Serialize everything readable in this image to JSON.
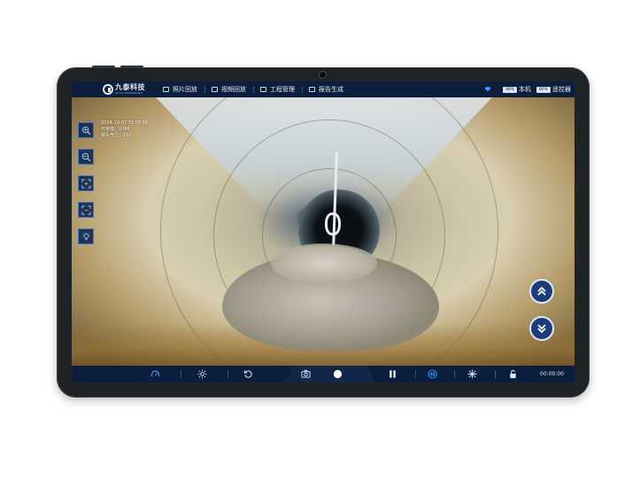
{
  "header": {
    "logo_name": "九泰科技",
    "logo_sub": "JIU TAI TECHNOLOGY",
    "nav": [
      {
        "label": "照片回放",
        "icon": "image-icon"
      },
      {
        "label": "视频回放",
        "icon": "film-icon"
      },
      {
        "label": "工程管理",
        "icon": "clipboard-icon"
      },
      {
        "label": "报告生成",
        "icon": "report-icon"
      }
    ],
    "battery_local_value": "98%",
    "battery_local_label": "本机",
    "battery_remote_value": "80%",
    "battery_remote_label": "遥控器"
  },
  "overlay": {
    "datetime": "2024-10-07 15:07:56",
    "meter": "计米值：0.0M",
    "pressure": "镜头气压：197"
  },
  "left_tools": [
    {
      "name": "zoom-in"
    },
    {
      "name": "zoom-out"
    },
    {
      "name": "focus-expand"
    },
    {
      "name": "focus-shrink"
    },
    {
      "name": "light"
    }
  ],
  "right_tools": [
    {
      "name": "up"
    },
    {
      "name": "down"
    }
  ],
  "footer": {
    "timer": "00:00:00"
  },
  "colors": {
    "bar_bg": "#0c1e3d",
    "accent": "#3a78d1",
    "icon_blue": "#39a0ff"
  }
}
